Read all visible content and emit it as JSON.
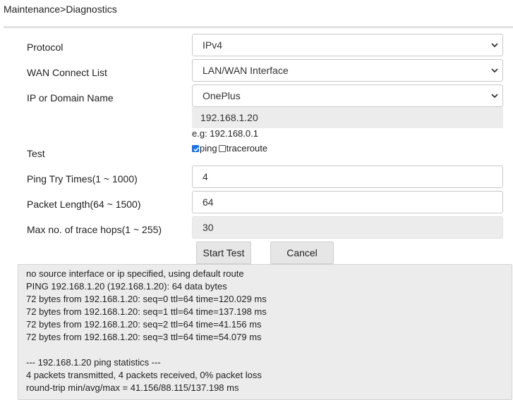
{
  "breadcrumb": "Maintenance>Diagnostics",
  "form": {
    "protocol": {
      "label": "Protocol",
      "value": "IPv4"
    },
    "wan_connect_list": {
      "label": "WAN Connect List",
      "value": "LAN/WAN Interface"
    },
    "ip_or_domain": {
      "label": "IP or Domain Name",
      "value": "OnePlus",
      "resolved_ip": "192.168.1.20",
      "hint": "e.g: 192.168.0.1"
    },
    "test": {
      "label": "Test",
      "ping_label": "ping",
      "ping_checked": true,
      "traceroute_label": "traceroute",
      "traceroute_checked": false
    },
    "ping_try_times": {
      "label": "Ping Try Times(1 ~ 1000)",
      "value": "4"
    },
    "packet_length": {
      "label": "Packet Length(64 ~ 1500)",
      "value": "64"
    },
    "max_trace_hops": {
      "label": "Max no. of trace hops(1 ~ 255)",
      "value": "30"
    }
  },
  "buttons": {
    "start_test": "Start Test",
    "cancel": "Cancel"
  },
  "output_lines": [
    "no source interface or ip specified, using default route",
    "PING 192.168.1.20 (192.168.1.20): 64 data bytes",
    "72 bytes from 192.168.1.20: seq=0 ttl=64 time=120.029 ms",
    "72 bytes from 192.168.1.20: seq=1 ttl=64 time=137.198 ms",
    "72 bytes from 192.168.1.20: seq=2 ttl=64 time=41.156 ms",
    "72 bytes from 192.168.1.20: seq=3 ttl=64 time=54.079 ms",
    "",
    "--- 192.168.1.20 ping statistics ---",
    "4 packets transmitted, 4 packets received, 0% packet loss",
    "round-trip min/avg/max = 41.156/88.115/137.198 ms"
  ],
  "colors": {
    "checkbox_accent": "#1a73e8",
    "readonly_bg": "#ececec"
  }
}
